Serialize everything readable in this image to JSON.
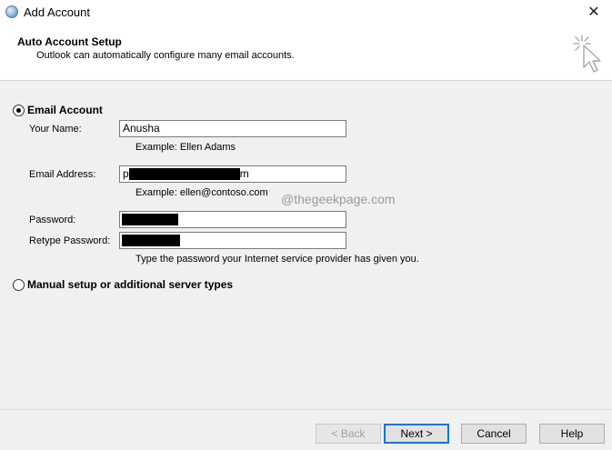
{
  "window": {
    "title": "Add Account",
    "close_glyph": "✕"
  },
  "header": {
    "title": "Auto Account Setup",
    "subtitle": "Outlook can automatically configure many email accounts."
  },
  "email_account": {
    "option_label": "Email Account",
    "selected": true,
    "your_name_label": "Your Name:",
    "your_name_value": "Anusha",
    "your_name_hint": "Example: Ellen Adams",
    "email_label": "Email Address:",
    "email_prefix": "p",
    "email_suffix": "m",
    "email_hint": "Example: ellen@contoso.com",
    "password_label": "Password:",
    "retype_label": "Retype Password:",
    "password_hint": "Type the password your Internet service provider has given you."
  },
  "manual_setup": {
    "option_label": "Manual setup or additional server types",
    "selected": false
  },
  "watermark": "@thegeekpage.com",
  "buttons": {
    "back": "< Back",
    "next": "Next >",
    "cancel": "Cancel",
    "help": "Help"
  },
  "icons": {
    "app": "outlook-globe-icon",
    "wizard": "cursor-sparkle-icon"
  }
}
